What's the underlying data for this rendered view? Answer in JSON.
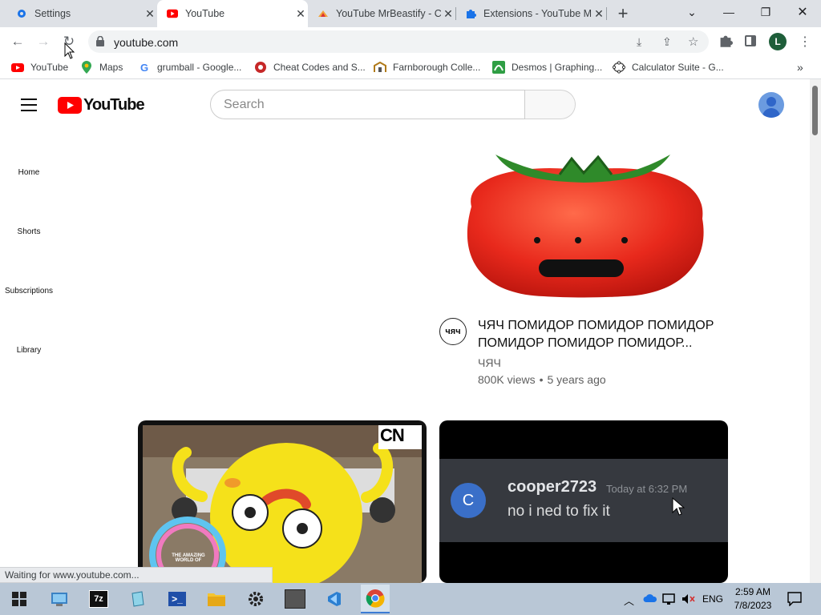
{
  "browser": {
    "tabs": [
      {
        "title": "Settings",
        "favicon": "gear-icon",
        "active": false
      },
      {
        "title": "YouTube",
        "favicon": "youtube-icon",
        "active": true
      },
      {
        "title": "YouTube MrBeastify - C",
        "favicon": "mrbeastify-icon",
        "active": false
      },
      {
        "title": "Extensions - YouTube M",
        "favicon": "puzzle-icon",
        "active": false
      }
    ],
    "new_tab_label": "+",
    "address": "youtube.com",
    "profile_initial": "L",
    "status_text": "Waiting for www.youtube.com...",
    "bookmarks": [
      {
        "label": "YouTube",
        "icon": "youtube-icon"
      },
      {
        "label": "Maps",
        "icon": "maps-pin-icon"
      },
      {
        "label": "grumball - Google...",
        "icon": "google-icon"
      },
      {
        "label": "Cheat Codes and S...",
        "icon": "cheat-codes-icon"
      },
      {
        "label": "Farnborough Colle...",
        "icon": "farnborough-icon"
      },
      {
        "label": "Desmos | Graphing...",
        "icon": "desmos-icon"
      },
      {
        "label": "Calculator Suite - G...",
        "icon": "geogebra-icon"
      }
    ]
  },
  "youtube": {
    "logo_text": "YouTube",
    "search_placeholder": "Search",
    "guide": [
      {
        "label": "Home"
      },
      {
        "label": "Shorts"
      },
      {
        "label": "Subscriptions"
      },
      {
        "label": "Library"
      }
    ],
    "videos": [
      {
        "title_line1": "ЧЯЧ ПОМИДОР ПОМИДОР ПОМИДОР",
        "title_line2": "ПОМИДОР ПОМИДОР ПОМИДОР...",
        "channel": "ЧЯЧ",
        "channel_avatar_text": "чяч",
        "views": "800K views",
        "separator": "•",
        "age": "5 years ago"
      },
      {
        "thumb_logo": "CN",
        "thumb_caption": "THE AMAZING WORLD OF"
      },
      {
        "thumb_avatar": "C",
        "thumb_user": "cooper2723",
        "thumb_time": "Today at 6:32 PM",
        "thumb_message": "no i ned to fix it"
      }
    ]
  },
  "taskbar": {
    "language": "ENG",
    "time": "2:59 AM",
    "date": "7/8/2023",
    "apps": [
      "windows-start-icon",
      "control-panel-icon",
      "7zip-icon",
      "notepad-icon",
      "powershell-icon",
      "file-explorer-icon",
      "settings-icon",
      "game-icon",
      "vscode-icon",
      "chrome-icon"
    ]
  }
}
